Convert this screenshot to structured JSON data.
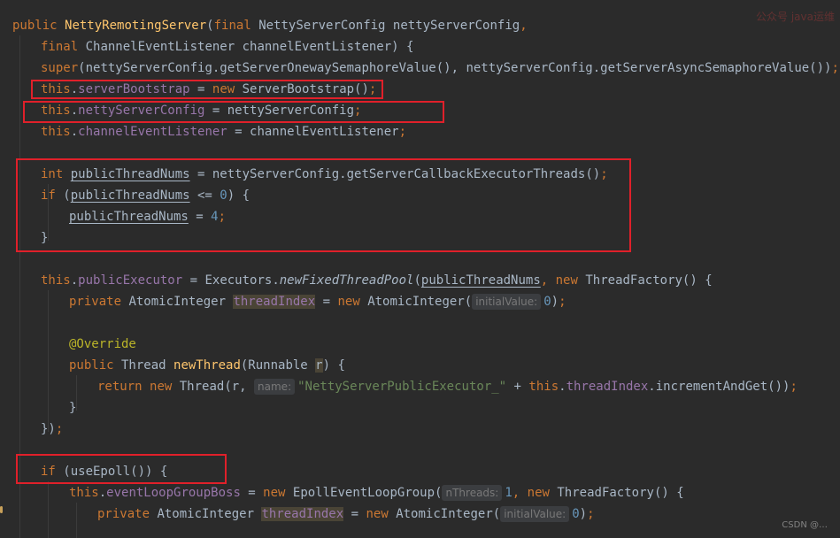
{
  "code": {
    "l1": {
      "kw1": "public",
      "name": "NettyRemotingServer",
      "p1": "(",
      "kw2": "final",
      "t1": " NettyServerConfig nettyServerConfig",
      "c1": ","
    },
    "l2": {
      "kw": "final",
      "t": " ChannelEventListener channelEventListener) {"
    },
    "l3": {
      "kw": "super",
      "t": "(nettyServerConfig.getServerOnewaySemaphoreValue(), nettyServerConfig.getServerAsyncSemaphoreValue())",
      "s": ";"
    },
    "l4": {
      "kw1": "this",
      "dot": ".",
      "field": "serverBootstrap",
      "eq": " = ",
      "kw2": "new",
      "t": " ServerBootstrap()",
      "s": ";"
    },
    "l5": {
      "kw1": "this",
      "dot": ".",
      "field": "nettyServerConfig",
      "t": " = nettyServerConfig",
      "s": ";"
    },
    "l6": {
      "kw1": "this",
      "dot": ".",
      "field": "channelEventListener",
      "t": " = channelEventListener",
      "s": ";"
    },
    "l7": {
      "kw": "int",
      "sp": " ",
      "var": "publicThreadNums",
      "t": " = nettyServerConfig.getServerCallbackExecutorThreads()",
      "s": ";"
    },
    "l8": {
      "kw": "if",
      "t1": " (",
      "var": "publicThreadNums",
      "t2": " <= ",
      "num": "0",
      "t3": ") {"
    },
    "l9": {
      "var": "publicThreadNums",
      "t": " = ",
      "num": "4",
      "s": ";"
    },
    "l10": {
      "t": "}"
    },
    "l11": {
      "kw1": "this",
      "dot": ".",
      "field": "publicExecutor",
      "t1": " = Executors.",
      "method": "newFixedThreadPool",
      "t2": "(",
      "var": "publicThreadNums",
      "c": ", ",
      "kw2": "new",
      "t3": " ThreadFactory() {"
    },
    "l12": {
      "kw1": "private",
      "t1": " AtomicInteger ",
      "field": "threadIndex",
      "t2": " = ",
      "kw2": "new",
      "t3": " AtomicInteger(",
      "hint": "initialValue:",
      "num": "0",
      "t4": ")",
      "s": ";"
    },
    "l13": {
      "ann": "@Override"
    },
    "l14": {
      "kw1": "public",
      "t1": " Thread ",
      "fn": "newThread",
      "t2": "(Runnable ",
      "param": "r",
      "t3": ") {"
    },
    "l15": {
      "kw1": "return",
      "sp": " ",
      "kw2": "new",
      "t1": " Thread(r, ",
      "hint": "name:",
      "str": "\"NettyServerPublicExecutor_\"",
      "t2": " + ",
      "kw3": "this",
      "dot": ".",
      "field": "threadIndex",
      "t3": ".incrementAndGet())",
      "s": ";"
    },
    "l16": {
      "t": "}"
    },
    "l17": {
      "t": "})",
      "s": ";"
    },
    "l18": {
      "kw": "if",
      "t": " (useEpoll()) {"
    },
    "l19": {
      "kw1": "this",
      "dot": ".",
      "field": "eventLoopGroupBoss",
      "t1": " = ",
      "kw2": "new",
      "t2": " EpollEventLoopGroup(",
      "hint": "nThreads:",
      "num": "1",
      "c": ", ",
      "kw3": "new",
      "t3": " ThreadFactory() {"
    },
    "l20": {
      "kw1": "private",
      "t1": " AtomicInteger ",
      "field": "threadIndex",
      "t2": " = ",
      "kw2": "new",
      "t3": " AtomicInteger(",
      "hint": "initialValue:",
      "num": "0",
      "t4": ")",
      "s": ";"
    }
  },
  "watermark": {
    "top_right": "公众号 java运维",
    "bottom": "CSDN @…"
  }
}
